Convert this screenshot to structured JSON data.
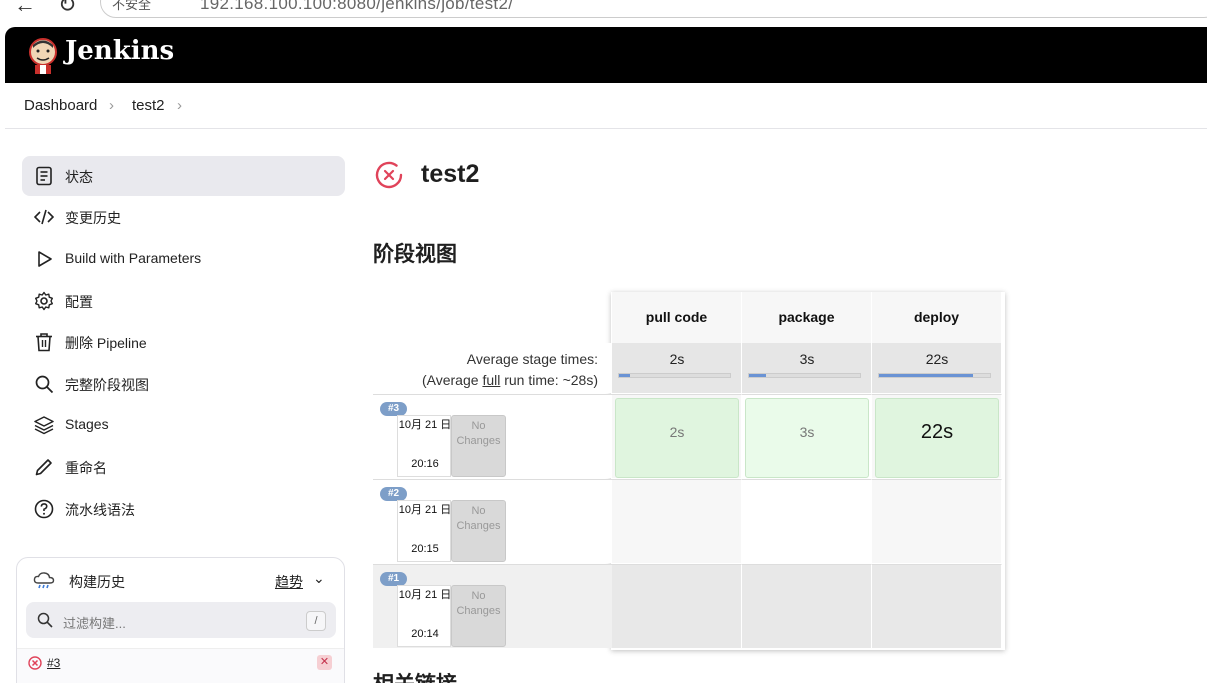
{
  "browser": {
    "security_label": "不安全",
    "url": "192.168.100.100:8080/jenkins/job/test2/"
  },
  "header": {
    "brand": "Jenkins"
  },
  "breadcrumb": {
    "items": [
      "Dashboard",
      "test2"
    ]
  },
  "sidebar": {
    "items": [
      {
        "label": "状态",
        "icon": "status-icon",
        "active": true
      },
      {
        "label": "变更历史",
        "icon": "code-icon"
      },
      {
        "label": "Build with Parameters",
        "icon": "play-icon"
      },
      {
        "label": "配置",
        "icon": "gear-icon"
      },
      {
        "label": "删除 Pipeline",
        "icon": "trash-icon"
      },
      {
        "label": "完整阶段视图",
        "icon": "search-icon"
      },
      {
        "label": "Stages",
        "icon": "layers-icon"
      },
      {
        "label": "重命名",
        "icon": "pencil-icon"
      },
      {
        "label": "流水线语法",
        "icon": "help-icon"
      }
    ]
  },
  "build_history": {
    "title": "构建历史",
    "trend": "趋势",
    "filter_placeholder": "过滤构建...",
    "shortcut": "/",
    "entries": [
      {
        "number": "#3",
        "status": "failed"
      }
    ]
  },
  "main": {
    "job_title": "test2",
    "job_status": "failed",
    "stage_view_title": "阶段视图",
    "related_title": "相关链接"
  },
  "stage_view": {
    "stages": [
      "pull code",
      "package",
      "deploy"
    ],
    "avg_label_1": "Average stage times:",
    "avg_label_2_prefix": "(Average ",
    "avg_label_2_link": "full",
    "avg_label_2_suffix": " run time: ~28s)",
    "avg_times": [
      "2s",
      "3s",
      "22s"
    ],
    "avg_fill_fraction": [
      0.1,
      0.15,
      0.85
    ],
    "runs": [
      {
        "badge": "#3",
        "date": "10月 21 日",
        "time": "20:16",
        "changes": "No Changes",
        "cells": [
          "2s",
          "3s",
          "22s"
        ]
      },
      {
        "badge": "#2",
        "date": "10月 21 日",
        "time": "20:15",
        "changes": "No Changes",
        "cells": [
          "",
          "",
          ""
        ]
      },
      {
        "badge": "#1",
        "date": "10月 21 日",
        "time": "20:14",
        "changes": "No Changes",
        "cells": [
          "",
          "",
          ""
        ]
      }
    ]
  },
  "colors": {
    "header_bg": "#000000",
    "success_cell": "#e0f5df",
    "fail_red": "#e0435a",
    "badge_blue": "#7d9ec8",
    "progress_blue": "#6a93d4"
  }
}
